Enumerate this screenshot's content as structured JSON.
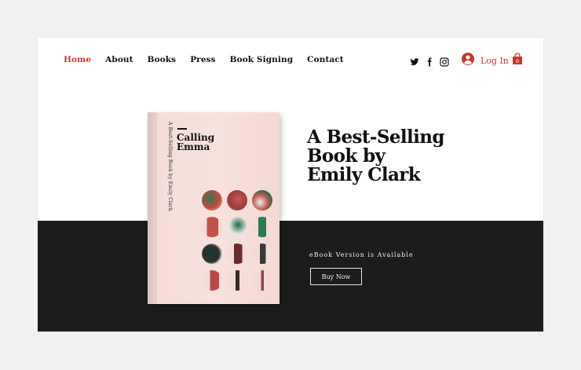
{
  "nav": {
    "items": [
      {
        "label": "Home",
        "active": true
      },
      {
        "label": "About"
      },
      {
        "label": "Books"
      },
      {
        "label": "Press"
      },
      {
        "label": "Book Signing"
      },
      {
        "label": "Contact"
      }
    ]
  },
  "social": {
    "icons": [
      "twitter-icon",
      "facebook-icon",
      "instagram-icon"
    ]
  },
  "account": {
    "login_label": "Log In",
    "avatar_icon": "user-avatar-icon"
  },
  "cart": {
    "count": "0",
    "icon": "shopping-bag-icon"
  },
  "book": {
    "title_line1": "Calling",
    "title_line2": "Emma",
    "spine_text": "A Best-Selling Book by Emily Clark"
  },
  "hero": {
    "headline_line1": "A Best-Selling",
    "headline_line2": "Book by",
    "headline_line3": "Emily Clark",
    "ebook_text": "eBook Version is Available",
    "buy_label": "Buy Now"
  },
  "colors": {
    "accent": "#c8352f",
    "dark_band": "#1c1c1c",
    "book_cover": "#f7e0dc"
  }
}
